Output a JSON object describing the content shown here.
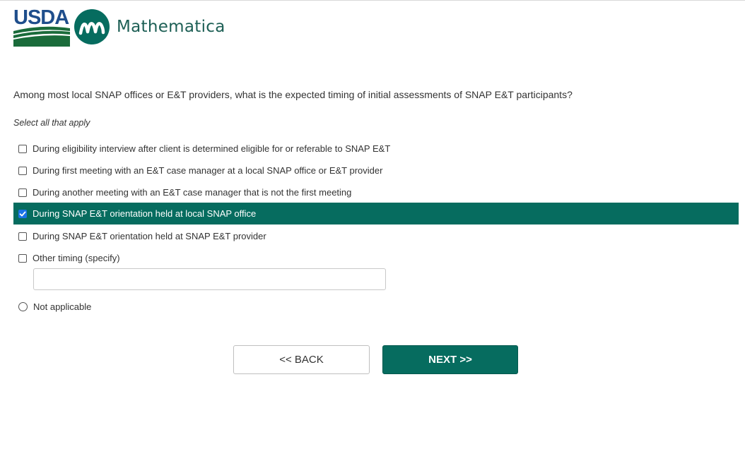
{
  "header": {
    "usda_text": "USDA",
    "brand_name": "Mathematica",
    "colors": {
      "usda_blue": "#1f4e8c",
      "usda_green": "#1a6b3a",
      "brand_green": "#066c5f"
    }
  },
  "question": {
    "text": "Among most local SNAP offices or E&T providers, what is the expected timing of initial assessments of SNAP E&T participants?",
    "hint": "Select all that apply"
  },
  "options": [
    {
      "label": "During eligibility interview after client is determined eligible for or referable to SNAP E&T",
      "checked": false,
      "type": "checkbox"
    },
    {
      "label": "During first meeting with an E&T case manager at a local SNAP office or E&T provider",
      "checked": false,
      "type": "checkbox"
    },
    {
      "label": "During another meeting with an E&T case manager that is not the first meeting",
      "checked": false,
      "type": "checkbox"
    },
    {
      "label": "During SNAP E&T orientation held at local SNAP office",
      "checked": true,
      "type": "checkbox"
    },
    {
      "label": "During SNAP E&T orientation held at SNAP E&T provider",
      "checked": false,
      "type": "checkbox"
    },
    {
      "label": "Other timing (specify)",
      "checked": false,
      "type": "checkbox"
    },
    {
      "label": "Not applicable",
      "checked": false,
      "type": "radio"
    }
  ],
  "specify_input": {
    "value": "",
    "placeholder": ""
  },
  "nav": {
    "back_label": "<< BACK",
    "next_label": "NEXT >>"
  }
}
